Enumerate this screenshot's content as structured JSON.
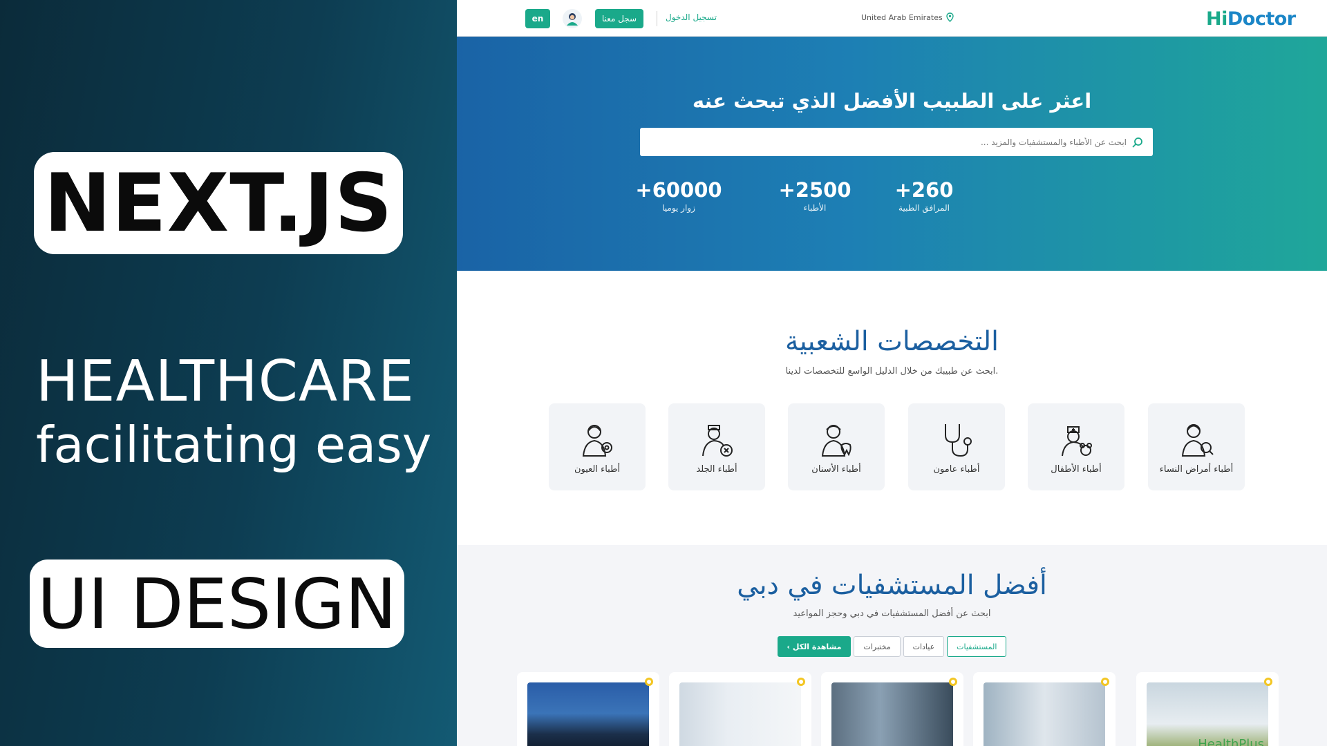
{
  "promo": {
    "badge_top": "NEXT.JS",
    "headline": "HEALTHCARE",
    "subheadline": "facilitating easy",
    "badge_bottom": "UI DESIGN"
  },
  "header": {
    "logo_prefix": "Hi",
    "logo_suffix": "Doctor",
    "location": "United Arab Emirates",
    "login_label": "تسجيل الدخول",
    "signup_label": "سجل معنا",
    "lang_label": "en"
  },
  "hero": {
    "title": "اعثر على الطبيب الأفضل الذي تبحث عنه",
    "search_placeholder": "ابحث عن الأطباء والمستشفيات والمزيد ...",
    "stats": [
      {
        "number": "+260",
        "label": "المرافق الطبية"
      },
      {
        "number": "+2500",
        "label": "الأطباء"
      },
      {
        "number": "+60000",
        "label": "زوار يوميا"
      }
    ]
  },
  "specialties": {
    "title": "التخصصات الشعبية",
    "subtitle": "ابحث عن طبيبك من خلال الدليل الواسع للتخصصات لدينا.",
    "items": [
      {
        "label": "أطباء أمراض النساء",
        "icon": "gynecologist-icon"
      },
      {
        "label": "أطباء الأطفال",
        "icon": "pediatrician-icon"
      },
      {
        "label": "أطباء عامون",
        "icon": "stethoscope-icon"
      },
      {
        "label": "أطباء الأسنان",
        "icon": "dentist-icon"
      },
      {
        "label": "أطباء الجلد",
        "icon": "dermatologist-icon"
      },
      {
        "label": "أطباء العيون",
        "icon": "ophthalmologist-icon"
      }
    ]
  },
  "hospitals": {
    "title": "أفضل المستشفيات في دبي",
    "subtitle": "ابحث عن أفضل المستشفيات في دبي وحجز المواعيد",
    "filters": [
      "المستشفيات",
      "عيادات",
      "مختبرات"
    ],
    "view_all_label": "مشاهدة الكل",
    "healthplus_label": "HealthPlus"
  },
  "colors": {
    "brand_green": "#1aa98a",
    "brand_blue": "#1b86c7",
    "promo_bg": "#0d3d52"
  }
}
